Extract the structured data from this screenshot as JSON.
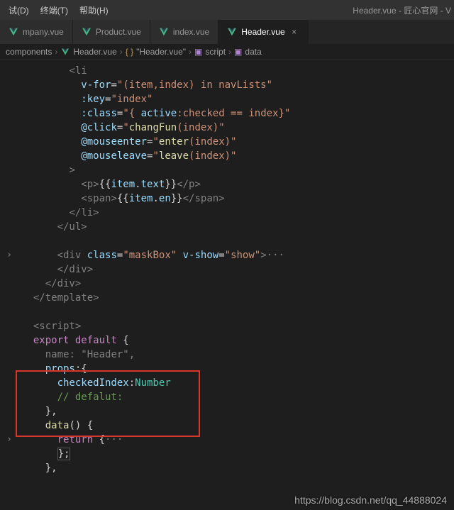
{
  "menubar": {
    "items": [
      "试(D)",
      "终端(T)",
      "帮助(H)"
    ],
    "title": "Header.vue - 匠心官网 - V"
  },
  "tabs": [
    {
      "label": "mpany.vue",
      "active": false,
      "close": false
    },
    {
      "label": "Product.vue",
      "active": false,
      "close": false
    },
    {
      "label": "index.vue",
      "active": false,
      "close": false
    },
    {
      "label": "Header.vue",
      "active": true,
      "close": true
    }
  ],
  "breadcrumb": {
    "c0": "components",
    "c1": "Header.vue",
    "c2": "\"Header.vue\"",
    "c3": "script",
    "c4": "data"
  },
  "code": {
    "l1": "<li",
    "l2_a": "v-for",
    "l2_b": "\"(item,index) in navLists\"",
    "l3_a": ":key",
    "l3_b": "\"index\"",
    "l4_a": ":class",
    "l4_b": "\"{ ",
    "l4_c": "active",
    "l4_d": ":checked == index}\"",
    "l5_a": "@click",
    "l5_b": "\"",
    "l5_c": "changFun",
    "l5_d": "(index)\"",
    "l6_a": "@mouseenter",
    "l6_b": "\"",
    "l6_c": "enter",
    "l6_d": "(index)\"",
    "l7_a": "@mouseleave",
    "l7_b": "\"",
    "l7_c": "leave",
    "l7_d": "(index)\"",
    "l8": ">",
    "l9_a": "<p>",
    "l9_b": "{{",
    "l9_c": "item",
    "l9_d": ".",
    "l9_e": "text",
    "l9_f": "}}",
    "l9_g": "</p>",
    "l10_a": "<span>",
    "l10_b": "{{",
    "l10_c": "item",
    "l10_d": ".",
    "l10_e": "en",
    "l10_f": "}}",
    "l10_g": "</span>",
    "l11": "</li>",
    "l12": "</ul>",
    "l13": "",
    "l14_a": "<div ",
    "l14_b": "class",
    "l14_c": "=",
    "l14_d": "\"maskBox\"",
    "l14_e": " v-show",
    "l14_f": "=",
    "l14_g": "\"show\"",
    "l14_h": ">",
    "l14_i": "···",
    "l15": "</div>",
    "l16": "</div>",
    "l17": "</template>",
    "l18": "",
    "l19": "<script>",
    "l20_a": "export",
    "l20_b": " default",
    "l20_c": " {",
    "l21_a": "name",
    "l21_b": ": ",
    "l21_c": "\"Header\"",
    "l21_d": ",",
    "l22_a": "props",
    "l22_b": ":{",
    "l23_a": "checkedIndex",
    "l23_b": ":",
    "l23_c": "Number",
    "l24": "// defalut:",
    "l25": "},",
    "l26_a": "data",
    "l26_b": "() {",
    "l27_a": "return",
    "l27_b": " {",
    "l27_c": "···",
    "l28": "};",
    "l29": "},"
  },
  "footer_url": "https://blog.csdn.net/qq_44888024"
}
